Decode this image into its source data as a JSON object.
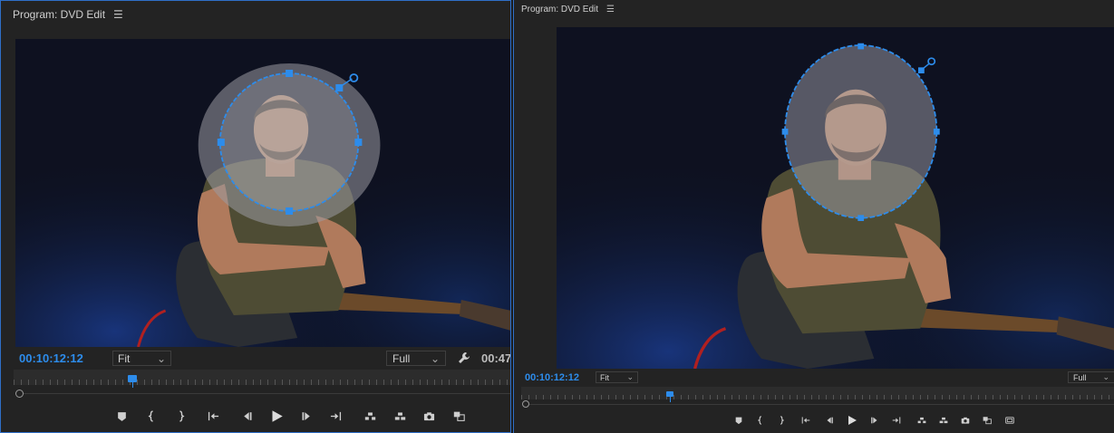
{
  "left_panel": {
    "title": "Program: DVD Edit",
    "menu_icon": "hamburger-icon",
    "timecode": "00:10:12:12",
    "fit_label": "Fit",
    "quality_label": "Full",
    "duration_partial": "00:47",
    "playhead_position": 0.23
  },
  "right_panel": {
    "title": "Program: DVD Edit",
    "menu_icon": "hamburger-icon",
    "timecode": "00:10:12:12",
    "fit_label": "Fit",
    "quality_label": "Full",
    "playhead_position": 0.245
  },
  "transport_icons": [
    "marker-icon",
    "mark-in-icon",
    "mark-out-icon",
    "go-to-in-icon",
    "step-back-icon",
    "play-icon",
    "step-forward-icon",
    "go-to-out-icon",
    "lift-icon",
    "extract-icon",
    "camera-icon",
    "compare-icon"
  ],
  "right_extra_icon": "safe-margins-icon",
  "colors": {
    "accent": "#2d8ceb",
    "panel_bg": "#232323",
    "border": "#2f6fc8"
  }
}
